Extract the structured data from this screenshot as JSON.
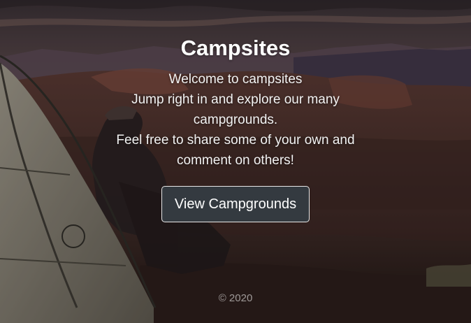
{
  "hero": {
    "title": "Campsites",
    "lines": [
      "Welcome to campsites",
      "Jump right in and explore our many campgrounds.",
      "Feel free to share some of your own and comment on others!"
    ],
    "button_label": "View Campgrounds"
  },
  "footer": {
    "text": "© 2020"
  },
  "colors": {
    "button_bg": "#343a40",
    "button_border": "#e8e8e8",
    "text": "#ffffff"
  }
}
